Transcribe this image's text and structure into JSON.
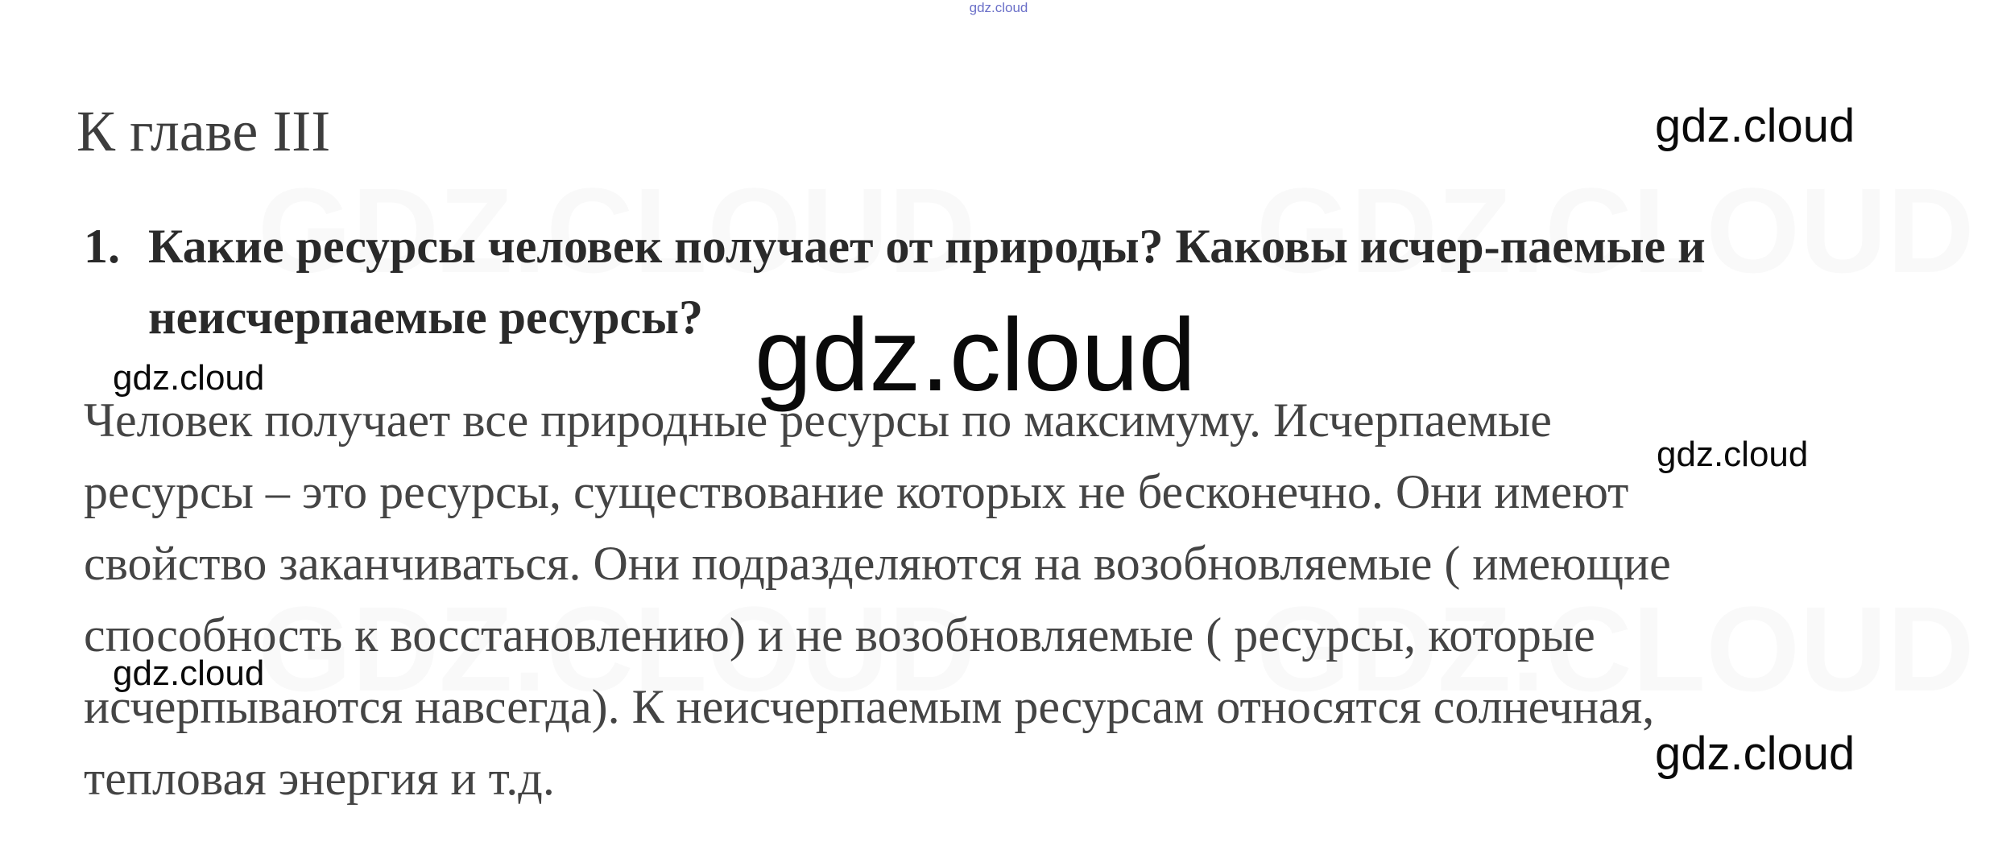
{
  "top_mark": "gdz.cloud",
  "chapter_heading": "К главе III",
  "question": {
    "number": "1.",
    "text": "Какие ресурсы человек получает от природы? Каковы исчер-паемые и неисчерпаемые ресурсы?"
  },
  "answer": {
    "lines": [
      "Человек получает все природные ресурсы по максимуму. Исчерпаемые",
      "ресурсы – это ресурсы, существование которых не бесконечно. Они имеют",
      "свойство заканчиваться. Они подразделяются на возобновляемые ( имеющие",
      "способность к восстановлению) и не возобновляемые ( ресурсы, которые",
      "исчерпываются навсегда). К неисчерпаемым ресурсам относятся солнечная,",
      "тепловая энергия и т.д."
    ]
  },
  "watermarks": {
    "top_right": "gdz.cloud",
    "center_large": "gdz.cloud",
    "left_upper": "gdz.cloud",
    "right_middle": "gdz.cloud",
    "left_lower": "gdz.cloud",
    "bottom_right": "gdz.cloud"
  }
}
